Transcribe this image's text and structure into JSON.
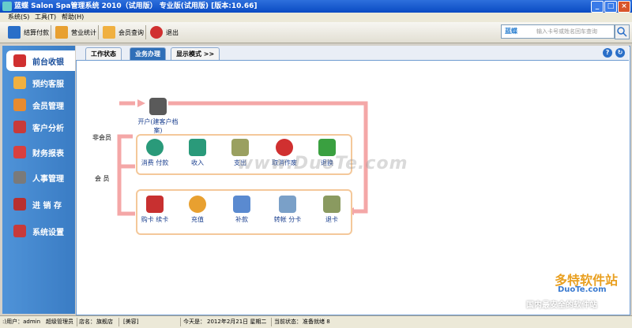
{
  "title": "蓝蝶 Salon Spa管理系统 2010（试用版）  专业版(试用版) [版本:10.66]",
  "window_buttons": {
    "minimize": "_",
    "maximize": "□",
    "close": "×"
  },
  "menu": [
    "系统(S)",
    "工具(T)",
    "帮助(H)"
  ],
  "toolbar": {
    "buttons": [
      {
        "label": "结算付款",
        "icon": "checkout-icon"
      },
      {
        "label": "营业统计",
        "icon": "stats-icon"
      },
      {
        "label": "会员查询",
        "icon": "members-icon"
      },
      {
        "label": "退出",
        "icon": "exit-icon"
      }
    ],
    "search": {
      "brand": "蓝蝶",
      "placeholder": "输入卡号或姓名回车查询"
    }
  },
  "sidebar": {
    "items": [
      {
        "label": "前台收银",
        "icon": "cashier-icon",
        "active": true
      },
      {
        "label": "预约客服",
        "icon": "appointment-icon"
      },
      {
        "label": "会员管理",
        "icon": "member-manage-icon"
      },
      {
        "label": "客户分析",
        "icon": "analysis-icon"
      },
      {
        "label": "财务报表",
        "icon": "report-icon"
      },
      {
        "label": "人事管理",
        "icon": "hr-icon"
      },
      {
        "label": "进 销 存",
        "icon": "inventory-icon"
      },
      {
        "label": "系统设置",
        "icon": "settings-icon"
      }
    ]
  },
  "tabs": [
    {
      "label": "工作状态",
      "active": false
    },
    {
      "label": "业务办理",
      "active": true
    },
    {
      "label": "显示模式 >>",
      "active": false
    }
  ],
  "flow": {
    "open_account": "开户(建客户档案)",
    "non_member_label": "非会员",
    "member_label": "会  员",
    "row1": [
      "消费 付款",
      "收入",
      "支出",
      "取消作废",
      "退换"
    ],
    "row2": [
      "购卡 续卡",
      "充值",
      "补款",
      "转帐 分卡",
      "退卡"
    ]
  },
  "statusbar": {
    "user": ":)用户：admin",
    "role": "超级管理员",
    "store": "店名：",
    "store_name": "旗舰店",
    "category": "[美容]",
    "today": "今天是：",
    "date": "2012年2月21日 星期二",
    "state_label": "当前状态：",
    "state": "准备就绪 8"
  },
  "watermark": {
    "text": "www.DuoTe.com",
    "corner_brand": "多特软件站",
    "corner_url": "DuoTe.com",
    "corner_tag": "国内最安全的软件站"
  },
  "colors": {
    "accent": "#3a7cc4",
    "flow_arrow": "#f4a7a7",
    "group_border": "#f4c89a"
  }
}
